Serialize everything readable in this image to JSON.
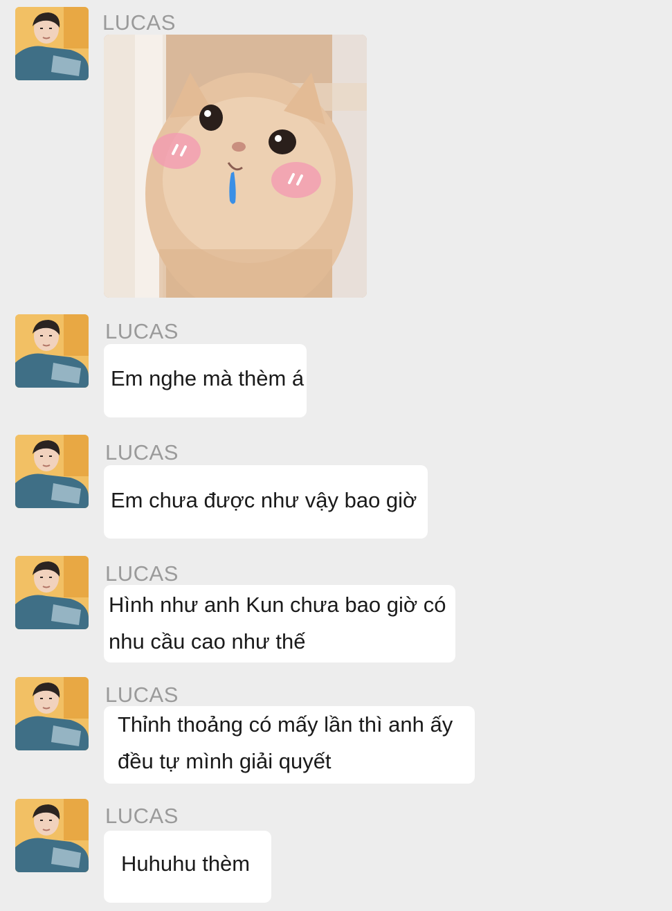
{
  "chat": {
    "messages": [
      {
        "sender": "LUCAS",
        "type": "image",
        "image_alt": "crying cat sticker"
      },
      {
        "sender": "LUCAS",
        "type": "text",
        "text": "Em nghe mà thèm á"
      },
      {
        "sender": "LUCAS",
        "type": "text",
        "text": "Em chưa được như vậy bao giờ"
      },
      {
        "sender": "LUCAS",
        "type": "text",
        "text_lines": [
          "Hình như anh Kun chưa bao giờ có",
          "nhu cầu cao như thế"
        ]
      },
      {
        "sender": "LUCAS",
        "type": "text",
        "text_lines": [
          "Thỉnh thoảng có mấy lần thì anh ấy",
          "đều tự mình giải quyết"
        ]
      },
      {
        "sender": "LUCAS",
        "type": "text",
        "text": "Huhuhu thèm"
      }
    ]
  },
  "colors": {
    "background": "#ededed",
    "bubble": "#ffffff",
    "sender_name": "#9a9a9a",
    "text": "#1a1a1a"
  },
  "icons": {
    "avatar": "profile-photo-avatar-icon"
  }
}
